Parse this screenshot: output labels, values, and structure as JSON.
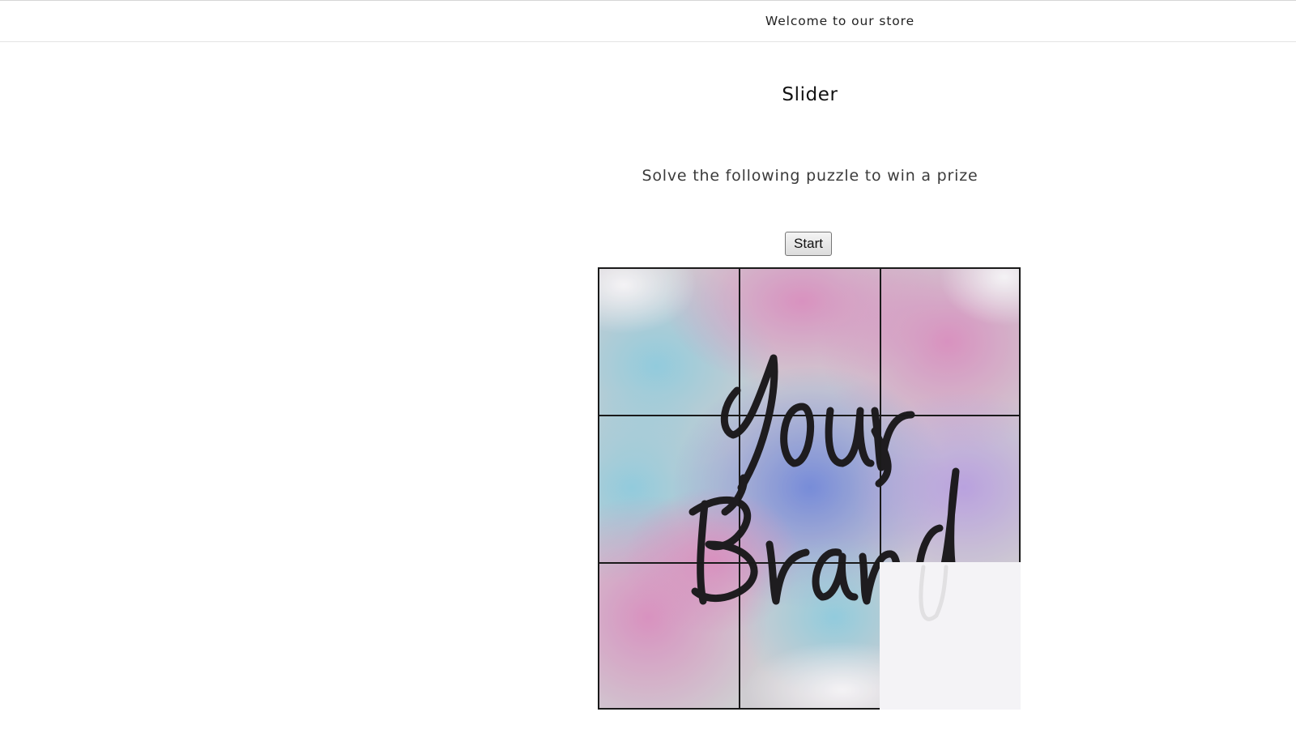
{
  "announcement": {
    "text": "Welcome to our store"
  },
  "section": {
    "title": "Slider",
    "subtitle": "Solve the following puzzle to win a prize"
  },
  "controls": {
    "start_label": "Start"
  },
  "puzzle": {
    "grid": "3x3",
    "empty_tile": "bottom-right",
    "image_text": "Your Brand",
    "colors": {
      "pink": "#d68fbe",
      "teal": "#8dc6d6",
      "blue": "#6f86d6",
      "violet": "#b79ad8",
      "grey": "#c8c5c9",
      "empty": "#f4f3f6",
      "ink": "#1e1c1f"
    }
  }
}
